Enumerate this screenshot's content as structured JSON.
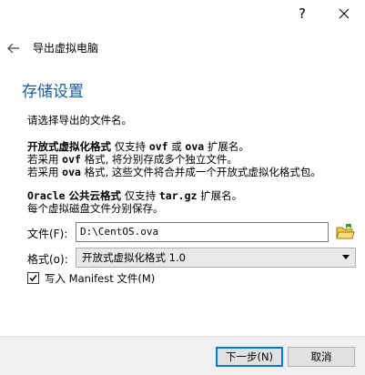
{
  "titlebar": {
    "help_label": "?",
    "close_icon": "close-icon"
  },
  "header": {
    "back_icon": "back-arrow-icon",
    "wizard_title": "导出虚拟电脑"
  },
  "page": {
    "title": "存储设置",
    "intro": "请选择导出的文件名。",
    "ovf": {
      "line1_bold": "开放式虚拟化格式",
      "line1_rest_a": " 仅支持 ",
      "line1_ext1": "ovf",
      "line1_rest_b": " 或 ",
      "line1_ext2": "ova",
      "line1_rest_c": " 扩展名。",
      "line2_a": "若采用 ",
      "line2_ext": "ovf",
      "line2_b": " 格式, 将分别存成多个独立文件。",
      "line3_a": "若采用 ",
      "line3_ext": "ova",
      "line3_b": " 格式, 这些文件将合并成一个开放式虚拟化格式包。"
    },
    "oracle": {
      "line1_bold_a": "Oracle",
      "line1_bold_b": " 公共云格式",
      "line1_rest_a": " 仅支持 ",
      "line1_ext": "tar.gz",
      "line1_rest_b": " 扩展名。",
      "line2": "每个虚拟磁盘文件分别保存。"
    }
  },
  "form": {
    "file_label": "文件(F):",
    "file_value": "D:\\CentOS.ova",
    "folder_icon": "folder-open-icon",
    "format_label": "格式(o):",
    "format_value": "开放式虚拟化格式 1.0",
    "manifest_label": "写入 Manifest 文件(M)",
    "manifest_checked": true
  },
  "buttons": {
    "next_label": "下一步(N)",
    "cancel_label": "取消"
  },
  "colors": {
    "title_blue": "#1a5c99",
    "focus_blue": "#0078d7",
    "folder_green": "#4a9a2a",
    "folder_yellow": "#f2c94c"
  }
}
